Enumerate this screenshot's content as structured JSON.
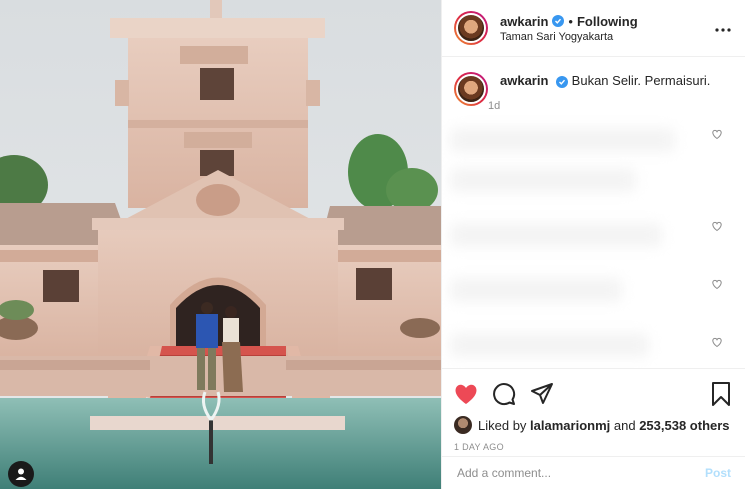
{
  "post": {
    "username": "awkarin",
    "follow_state": "Following",
    "separator": "•",
    "location": "Taman Sari Yogyakarta",
    "more_icon": "more-horizontal-icon",
    "verified_icon": "verified-badge-icon"
  },
  "caption": {
    "username": "awkarin",
    "text": "Bukan Selir. Permaisuri.",
    "time": "1d"
  },
  "actions": {
    "icons": [
      "heart-icon",
      "comment-icon",
      "share-icon",
      "bookmark-icon"
    ],
    "liked": true,
    "like_color": "#ed4956"
  },
  "likes": {
    "prefix": "Liked by",
    "user": "lalamarionmj",
    "middle": "and",
    "count": "253,538 others"
  },
  "timestamp": "1 DAY AGO",
  "comment_box": {
    "placeholder": "Add a comment...",
    "post_label": "Post"
  },
  "colors": {
    "accent_blue": "#3897f0",
    "post_disabled": "#b2dffc",
    "muted": "#8e8e8e"
  }
}
